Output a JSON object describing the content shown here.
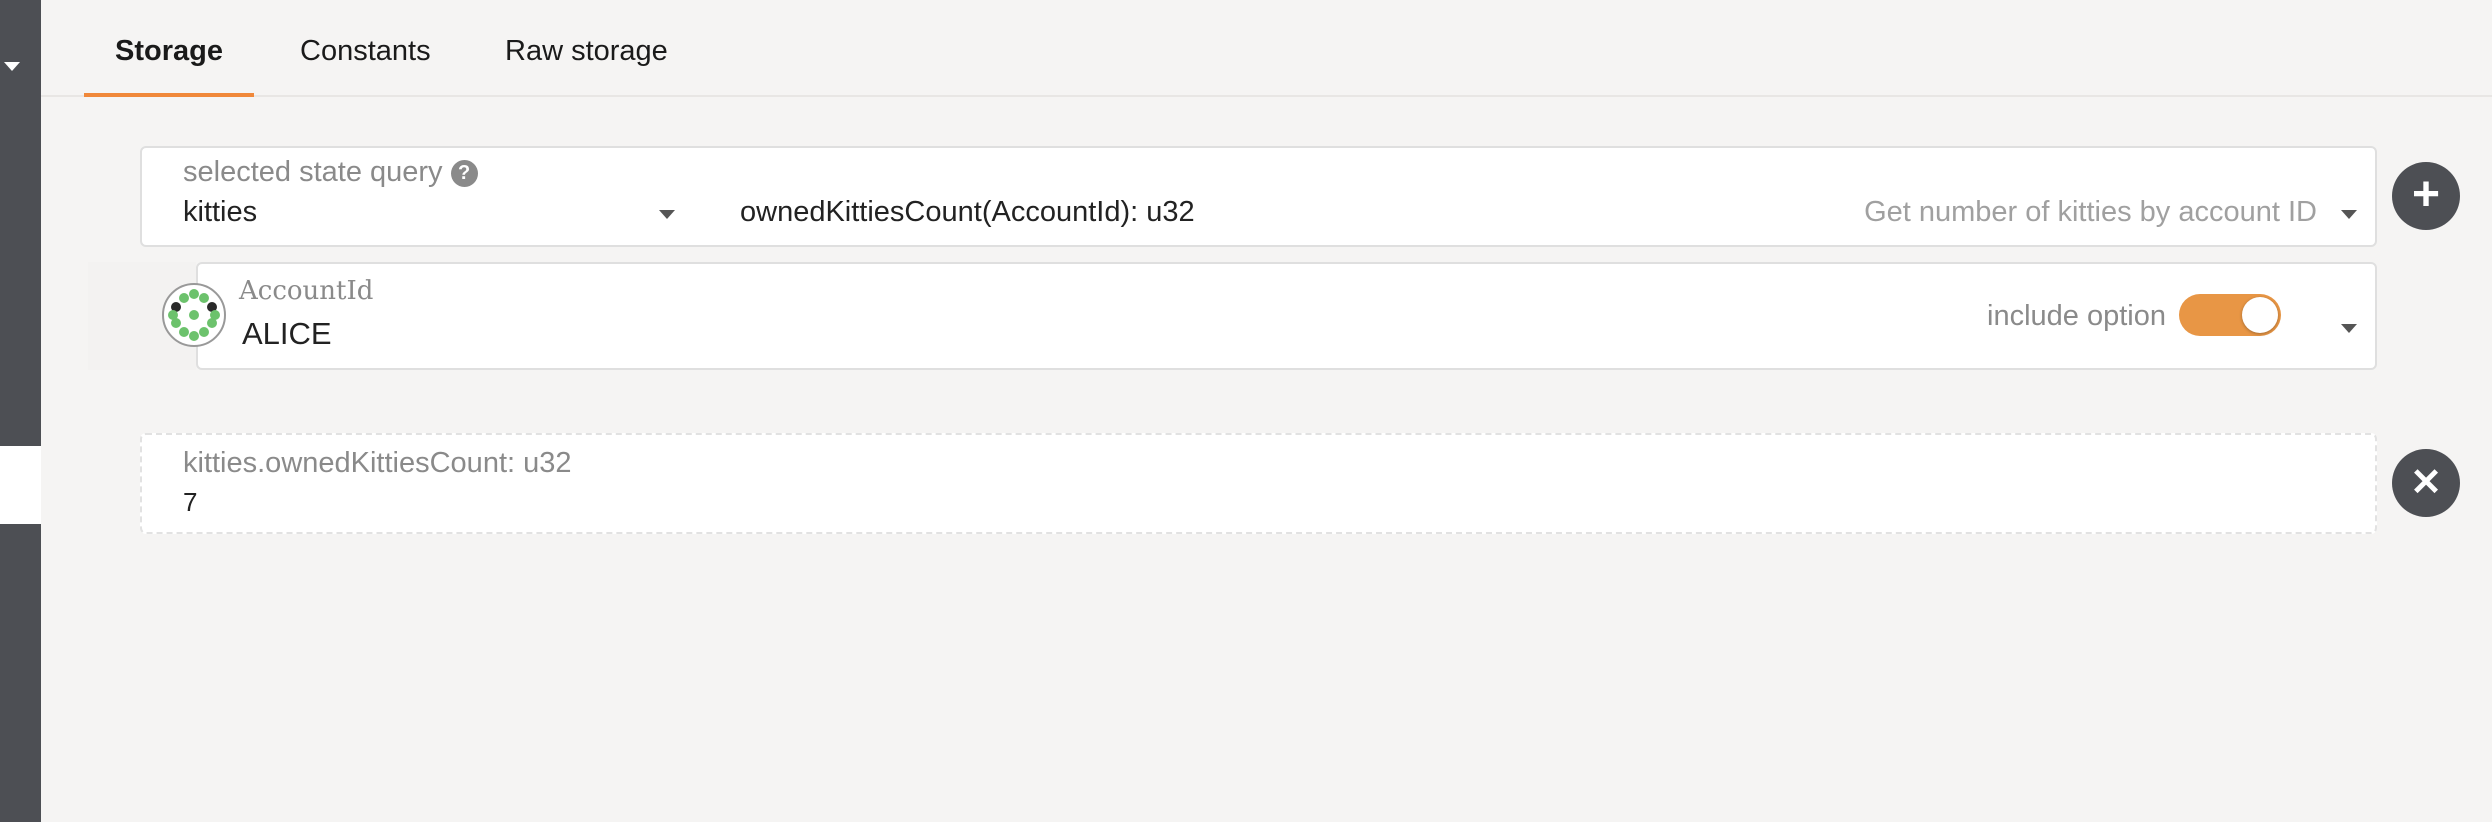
{
  "tabs": [
    {
      "label": "Storage",
      "active": true
    },
    {
      "label": "Constants",
      "active": false
    },
    {
      "label": "Raw storage",
      "active": false
    }
  ],
  "query": {
    "label": "selected state query",
    "help_icon": "question-circle-icon",
    "module": "kitties",
    "method": "ownedKittiesCount(AccountId): u32",
    "description": "Get number of kitties by account ID"
  },
  "param": {
    "label": "AccountId",
    "value": "ALICE",
    "include_option_label": "include option",
    "include_option_on": true
  },
  "result": {
    "label": "kitties.ownedKittiesCount: u32",
    "value": "7"
  },
  "buttons": {
    "add_icon": "plus-icon",
    "remove_icon": "close-icon"
  },
  "colors": {
    "accent": "#f0883a",
    "toggle": "#e89645",
    "sidebar": "#4d4f54"
  }
}
